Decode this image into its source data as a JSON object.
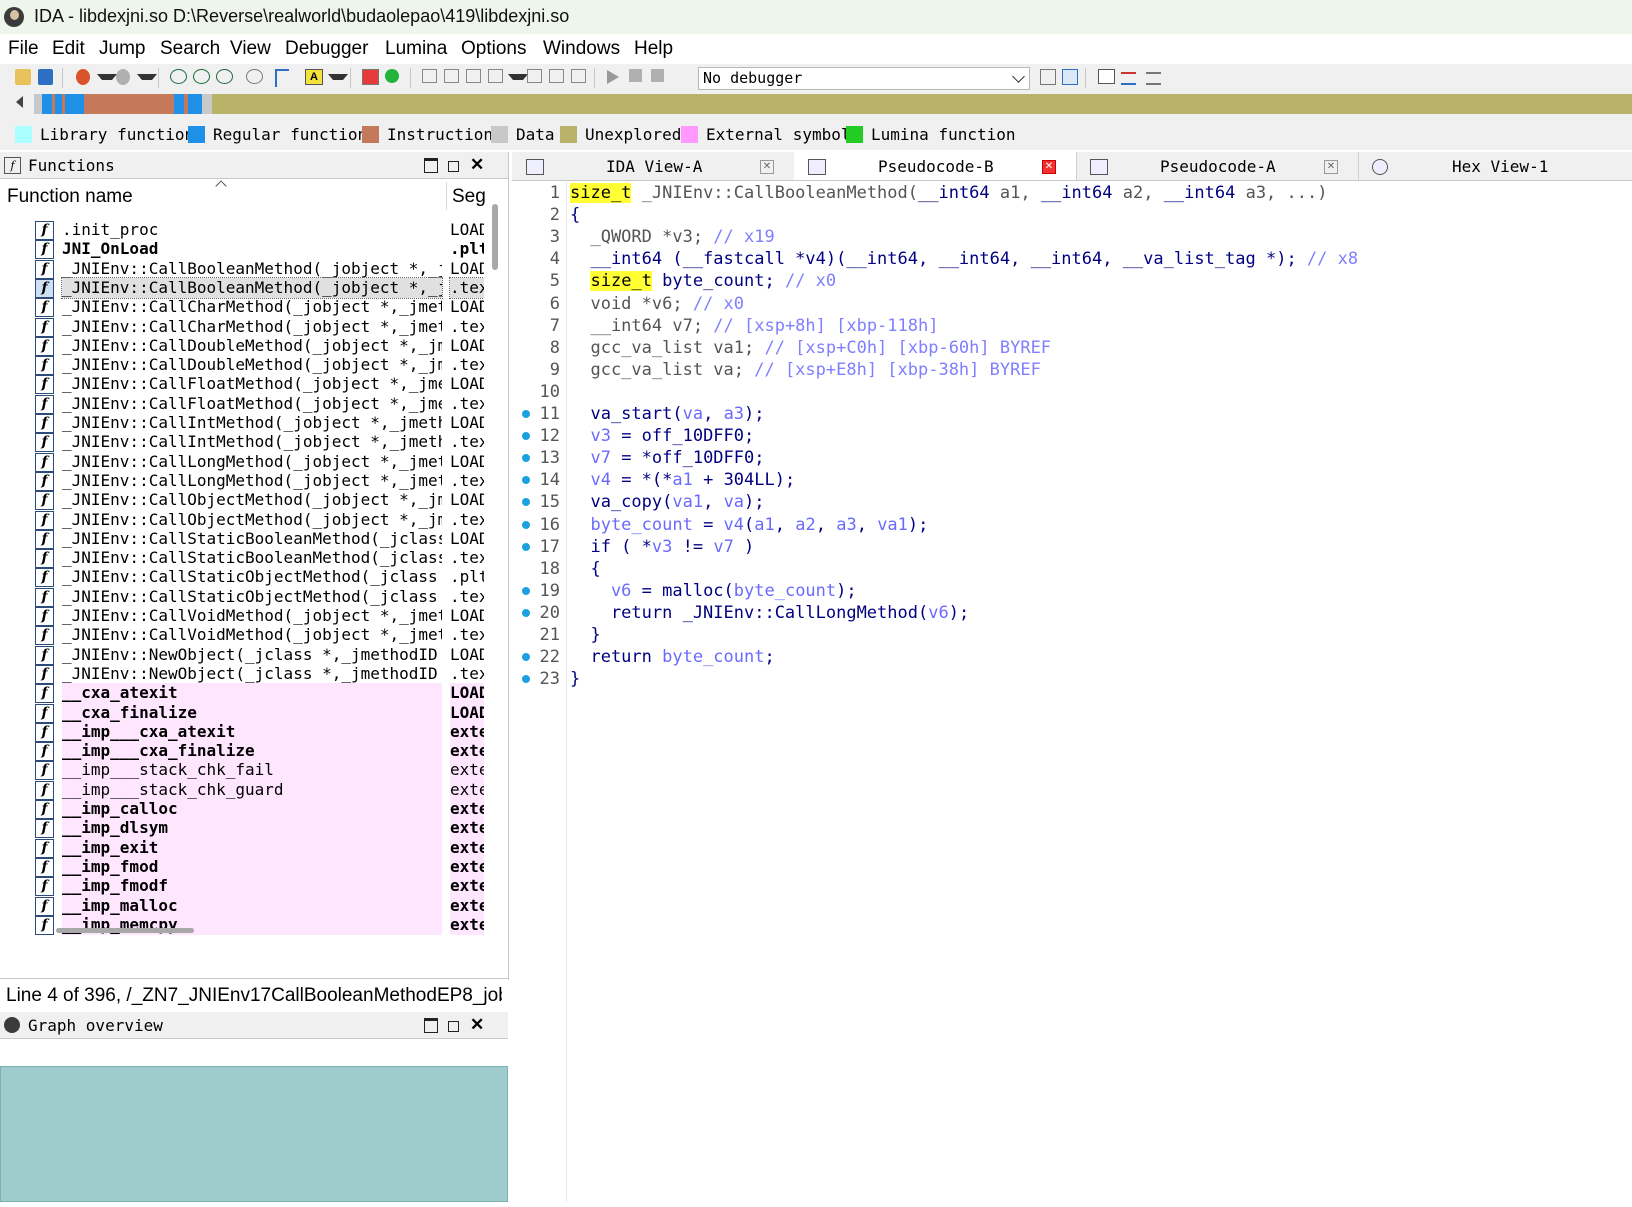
{
  "window": {
    "title": "IDA - libdexjni.so D:\\Reverse\\realworld\\budaolepao\\419\\libdexjni.so"
  },
  "menu": [
    "File",
    "Edit",
    "Jump",
    "Search",
    "View",
    "Debugger",
    "Lumina",
    "Options",
    "Windows",
    "Help"
  ],
  "toolbar": {
    "debugger_select": "No debugger"
  },
  "legend": [
    {
      "label": "Library function",
      "color": "#aaffff"
    },
    {
      "label": "Regular function",
      "color": "#1e90e8"
    },
    {
      "label": "Instruction",
      "color": "#c47a5a"
    },
    {
      "label": "Data",
      "color": "#c8c8c8"
    },
    {
      "label": "Unexplored",
      "color": "#b9b36a"
    },
    {
      "label": "External symbol",
      "color": "#ff99ff"
    },
    {
      "label": "Lumina function",
      "color": "#22cc22"
    }
  ],
  "functions_panel": {
    "title": "Functions",
    "col_name": "Function name",
    "col_seg": "Seg",
    "rows": [
      {
        "name": ".init_proc",
        "seg": "LOAD",
        "type": "normal"
      },
      {
        "name": "JNI_OnLoad",
        "seg": ".plt",
        "type": "bold"
      },
      {
        "name": "_JNIEnv::CallBooleanMethod(_jobject *,_j⋯",
        "seg": "LOAD",
        "type": "normal"
      },
      {
        "name": "_JNIEnv::CallBooleanMethod(_jobject *,_j⋯",
        "seg": ".text",
        "type": "selected"
      },
      {
        "name": "_JNIEnv::CallCharMethod(_jobject *,_jmet⋯",
        "seg": "LOAD",
        "type": "normal"
      },
      {
        "name": "_JNIEnv::CallCharMethod(_jobject *,_jmet⋯",
        "seg": ".text",
        "type": "normal"
      },
      {
        "name": "_JNIEnv::CallDoubleMethod(_jobject *,_jm⋯",
        "seg": "LOAD",
        "type": "normal"
      },
      {
        "name": "_JNIEnv::CallDoubleMethod(_jobject *,_jm⋯",
        "seg": ".text",
        "type": "normal"
      },
      {
        "name": "_JNIEnv::CallFloatMethod(_jobject *,_jme⋯",
        "seg": "LOAD",
        "type": "normal"
      },
      {
        "name": "_JNIEnv::CallFloatMethod(_jobject *,_jme⋯",
        "seg": ".text",
        "type": "normal"
      },
      {
        "name": "_JNIEnv::CallIntMethod(_jobject *,_jmeth⋯",
        "seg": "LOAD",
        "type": "normal"
      },
      {
        "name": "_JNIEnv::CallIntMethod(_jobject *,_jmeth⋯",
        "seg": ".text",
        "type": "normal"
      },
      {
        "name": "_JNIEnv::CallLongMethod(_jobject *,_jmet⋯",
        "seg": "LOAD",
        "type": "normal"
      },
      {
        "name": "_JNIEnv::CallLongMethod(_jobject *,_jmet⋯",
        "seg": ".text",
        "type": "normal"
      },
      {
        "name": "_JNIEnv::CallObjectMethod(_jobject *,_jm⋯",
        "seg": "LOAD",
        "type": "normal"
      },
      {
        "name": "_JNIEnv::CallObjectMethod(_jobject *,_jm⋯",
        "seg": ".text",
        "type": "normal"
      },
      {
        "name": "_JNIEnv::CallStaticBooleanMethod(_jclass⋯",
        "seg": "LOAD",
        "type": "normal"
      },
      {
        "name": "_JNIEnv::CallStaticBooleanMethod(_jclass⋯",
        "seg": ".text",
        "type": "normal"
      },
      {
        "name": "_JNIEnv::CallStaticObjectMethod(_jclass ⋯",
        "seg": ".plt",
        "type": "normal"
      },
      {
        "name": "_JNIEnv::CallStaticObjectMethod(_jclass ⋯",
        "seg": ".text",
        "type": "normal"
      },
      {
        "name": "_JNIEnv::CallVoidMethod(_jobject *,_jmet⋯",
        "seg": "LOAD",
        "type": "normal"
      },
      {
        "name": "_JNIEnv::CallVoidMethod(_jobject *,_jmet⋯",
        "seg": ".text",
        "type": "normal"
      },
      {
        "name": "_JNIEnv::NewObject(_jclass *,_jmethodID ⋯",
        "seg": "LOAD",
        "type": "normal"
      },
      {
        "name": "_JNIEnv::NewObject(_jclass *,_jmethodID ⋯",
        "seg": ".text",
        "type": "normal"
      },
      {
        "name": "__cxa_atexit",
        "seg": "LOAD",
        "type": "ext-bold"
      },
      {
        "name": "__cxa_finalize",
        "seg": "LOAD",
        "type": "ext-bold"
      },
      {
        "name": "__imp___cxa_atexit",
        "seg": "extern",
        "type": "ext-bold"
      },
      {
        "name": "__imp___cxa_finalize",
        "seg": "extern",
        "type": "ext-bold"
      },
      {
        "name": "__imp___stack_chk_fail",
        "seg": "extern",
        "type": "ext"
      },
      {
        "name": "__imp___stack_chk_guard",
        "seg": "extern",
        "type": "ext"
      },
      {
        "name": "__imp_calloc",
        "seg": "extern",
        "type": "ext-bold"
      },
      {
        "name": "__imp_dlsym",
        "seg": "extern",
        "type": "ext-bold"
      },
      {
        "name": "__imp_exit",
        "seg": "extern",
        "type": "ext-bold"
      },
      {
        "name": "__imp_fmod",
        "seg": "extern",
        "type": "ext-bold"
      },
      {
        "name": "__imp_fmodf",
        "seg": "extern",
        "type": "ext-bold"
      },
      {
        "name": "__imp_malloc",
        "seg": "extern",
        "type": "ext-bold"
      },
      {
        "name": "__imp_memcpy",
        "seg": "extern",
        "type": "ext-bold"
      }
    ]
  },
  "status_line": "Line 4 of 396, /_ZN7_JNIEnv17CallBooleanMethodEP8_jobject",
  "graph_panel": {
    "title": "Graph overview"
  },
  "tabs": [
    {
      "label": "IDA View-A",
      "active": false,
      "close_red": false
    },
    {
      "label": "Pseudocode-B",
      "active": true,
      "close_red": true
    },
    {
      "label": "Pseudocode-A",
      "active": false,
      "close_red": false
    },
    {
      "label": "Hex View-1",
      "active": false,
      "close_red": false
    }
  ],
  "code": {
    "lines": [
      {
        "n": "1",
        "bp": false,
        "t": [
          [
            "hl",
            "size_t"
          ],
          [
            "gr",
            " _JNIEnv::CallBooleanMethod("
          ],
          [
            "kw",
            "__int64"
          ],
          [
            "gr",
            " a1, "
          ],
          [
            "kw",
            "__int64"
          ],
          [
            "gr",
            " a2, "
          ],
          [
            "kw",
            "__int64"
          ],
          [
            "gr",
            " a3, ...)"
          ]
        ]
      },
      {
        "n": "2",
        "bp": false,
        "t": [
          [
            "kw",
            "{"
          ]
        ]
      },
      {
        "n": "3",
        "bp": false,
        "t": [
          [
            "gr",
            "  _QWORD *v3; "
          ],
          [
            "cm",
            "// x19"
          ]
        ]
      },
      {
        "n": "4",
        "bp": false,
        "t": [
          [
            "kw",
            "  __int64 (__fastcall *v4)(__int64, __int64, __int64, __va_list_tag *); "
          ],
          [
            "cm",
            "// x8"
          ]
        ]
      },
      {
        "n": "5",
        "bp": false,
        "t": [
          [
            "gr",
            "  "
          ],
          [
            "hl",
            "size_t"
          ],
          [
            "kw",
            " byte_count; "
          ],
          [
            "cm",
            "// x0"
          ]
        ]
      },
      {
        "n": "6",
        "bp": false,
        "t": [
          [
            "gr",
            "  void *v6; "
          ],
          [
            "cm",
            "// x0"
          ]
        ]
      },
      {
        "n": "7",
        "bp": false,
        "t": [
          [
            "gr",
            "  __int64 v7; "
          ],
          [
            "cm",
            "// [xsp+8h] [xbp-118h]"
          ]
        ]
      },
      {
        "n": "8",
        "bp": false,
        "t": [
          [
            "gr",
            "  gcc_va_list va1; "
          ],
          [
            "cm",
            "// [xsp+C0h] [xbp-60h] BYREF"
          ]
        ]
      },
      {
        "n": "9",
        "bp": false,
        "t": [
          [
            "gr",
            "  gcc_va_list va; "
          ],
          [
            "cm",
            "// [xsp+E8h] [xbp-38h] BYREF"
          ]
        ]
      },
      {
        "n": "10",
        "bp": false,
        "t": []
      },
      {
        "n": "11",
        "bp": true,
        "t": [
          [
            "kw",
            "  va_start("
          ],
          [
            "vr",
            "va"
          ],
          [
            "kw",
            ", "
          ],
          [
            "vr",
            "a3"
          ],
          [
            "kw",
            ");"
          ]
        ]
      },
      {
        "n": "12",
        "bp": true,
        "t": [
          [
            "vr",
            "  v3"
          ],
          [
            "kw",
            " = off_10DFF0;"
          ]
        ]
      },
      {
        "n": "13",
        "bp": true,
        "t": [
          [
            "vr",
            "  v7"
          ],
          [
            "kw",
            " = *off_10DFF0;"
          ]
        ]
      },
      {
        "n": "14",
        "bp": true,
        "t": [
          [
            "vr",
            "  v4"
          ],
          [
            "kw",
            " = *(*"
          ],
          [
            "vr",
            "a1"
          ],
          [
            "kw",
            " + 304LL);"
          ]
        ]
      },
      {
        "n": "15",
        "bp": true,
        "t": [
          [
            "kw",
            "  va_copy("
          ],
          [
            "vr",
            "va1"
          ],
          [
            "kw",
            ", "
          ],
          [
            "vr",
            "va"
          ],
          [
            "kw",
            ");"
          ]
        ]
      },
      {
        "n": "16",
        "bp": true,
        "t": [
          [
            "vr",
            "  byte_count"
          ],
          [
            "kw",
            " = "
          ],
          [
            "vr",
            "v4"
          ],
          [
            "kw",
            "("
          ],
          [
            "vr",
            "a1"
          ],
          [
            "kw",
            ", "
          ],
          [
            "vr",
            "a2"
          ],
          [
            "kw",
            ", "
          ],
          [
            "vr",
            "a3"
          ],
          [
            "kw",
            ", "
          ],
          [
            "vr",
            "va1"
          ],
          [
            "kw",
            ");"
          ]
        ]
      },
      {
        "n": "17",
        "bp": true,
        "t": [
          [
            "kw",
            "  if ( *"
          ],
          [
            "vr",
            "v3"
          ],
          [
            "kw",
            " != "
          ],
          [
            "vr",
            "v7"
          ],
          [
            "kw",
            " )"
          ]
        ]
      },
      {
        "n": "18",
        "bp": false,
        "t": [
          [
            "kw",
            "  {"
          ]
        ]
      },
      {
        "n": "19",
        "bp": true,
        "t": [
          [
            "vr",
            "    v6"
          ],
          [
            "kw",
            " = malloc("
          ],
          [
            "vr",
            "byte_count"
          ],
          [
            "kw",
            ");"
          ]
        ]
      },
      {
        "n": "20",
        "bp": true,
        "t": [
          [
            "kw",
            "    return _JNIEnv::CallLongMethod("
          ],
          [
            "vr",
            "v6"
          ],
          [
            "kw",
            ");"
          ]
        ]
      },
      {
        "n": "21",
        "bp": false,
        "t": [
          [
            "kw",
            "  }"
          ]
        ]
      },
      {
        "n": "22",
        "bp": true,
        "t": [
          [
            "kw",
            "  return "
          ],
          [
            "vr",
            "byte_count"
          ],
          [
            "kw",
            ";"
          ]
        ]
      },
      {
        "n": "23",
        "bp": true,
        "t": [
          [
            "kw",
            "}"
          ]
        ]
      }
    ]
  }
}
